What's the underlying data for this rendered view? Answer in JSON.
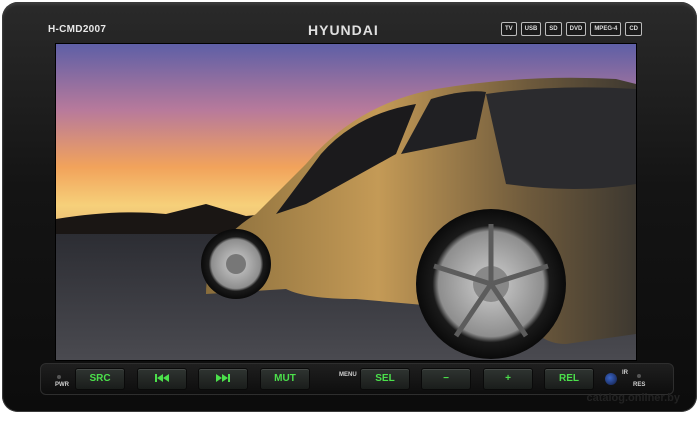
{
  "device": {
    "model": "H-CMD2007",
    "brand": "HYUNDAI",
    "badges": [
      "TV",
      "USB",
      "SD",
      "DVD",
      "MPEG-4",
      "CD"
    ]
  },
  "controls": {
    "pwr_label": "PWR",
    "src_label": "SRC",
    "mut_label": "MUT",
    "menu_label": "MENU",
    "sel_label": "SEL",
    "minus_label": "−",
    "plus_label": "+",
    "rel_label": "REL",
    "ir_label": "IR",
    "res_label": "RES"
  },
  "footer": {
    "watermark": "catalog.onliner.by"
  },
  "colors": {
    "button_text": "#4be04b",
    "bezel": "#141414"
  },
  "icons": {
    "prev": "prev-track-icon",
    "next": "next-track-icon",
    "remote": "ir-sensor-icon"
  }
}
